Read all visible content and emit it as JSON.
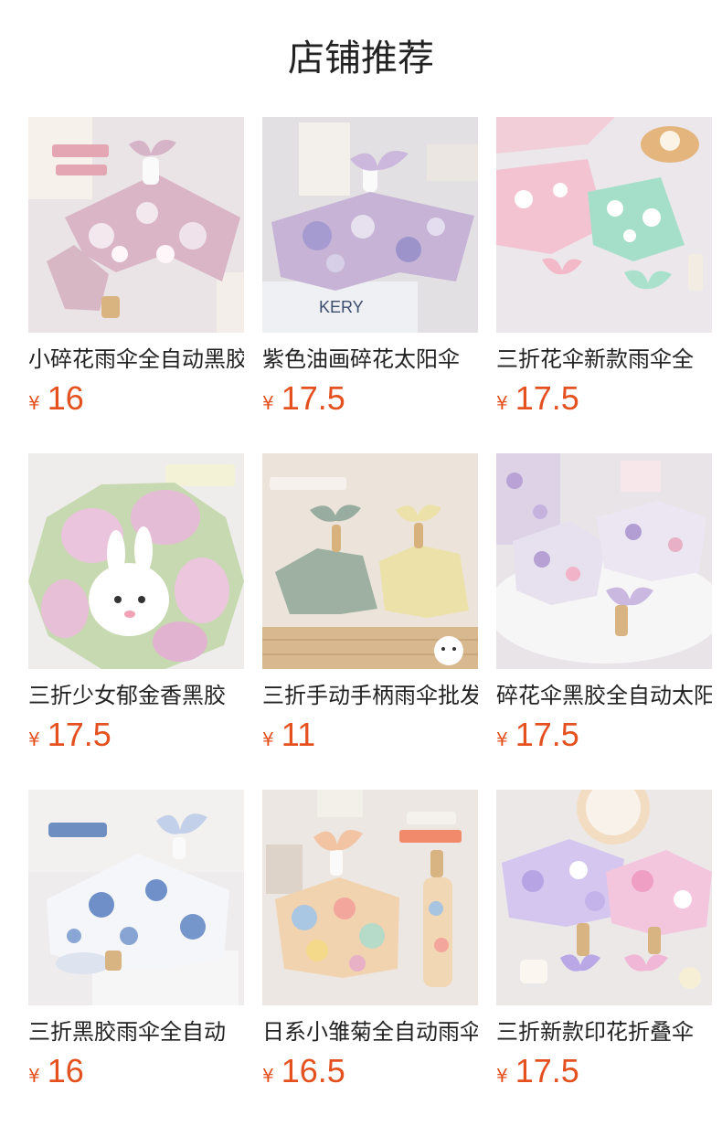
{
  "section": {
    "title": "店铺推荐"
  },
  "currency_symbol": "¥",
  "colors": {
    "price": "#e4501e",
    "text": "#222222"
  },
  "products": [
    {
      "name": "小碎花雨伞全自动黑胶",
      "price": "16",
      "image": "pink-floral-umbrella-bow"
    },
    {
      "name": "紫色油画碎花太阳伞",
      "price": "17.5",
      "image": "purple-oil-painting-umbrella"
    },
    {
      "name": "三折花伞新款雨伞全",
      "price": "17.5",
      "image": "pink-and-mint-daisy-umbrellas"
    },
    {
      "name": "三折少女郁金香黑胶",
      "price": "17.5",
      "image": "tulip-bunny-umbrella"
    },
    {
      "name": "三折手动手柄雨伞批发",
      "price": "11",
      "image": "sage-and-yellow-umbrellas"
    },
    {
      "name": "碎花伞黑胶全自动太阳",
      "price": "17.5",
      "image": "lilac-floral-umbrella"
    },
    {
      "name": "三折黑胶雨伞全自动",
      "price": "16",
      "image": "blue-flower-umbrella"
    },
    {
      "name": "日系小雏菊全自动雨伞",
      "price": "16.5",
      "image": "pastel-daisy-umbrella"
    },
    {
      "name": "三折新款印花折叠伞",
      "price": "17.5",
      "image": "violet-pink-floral-umbrellas"
    }
  ]
}
